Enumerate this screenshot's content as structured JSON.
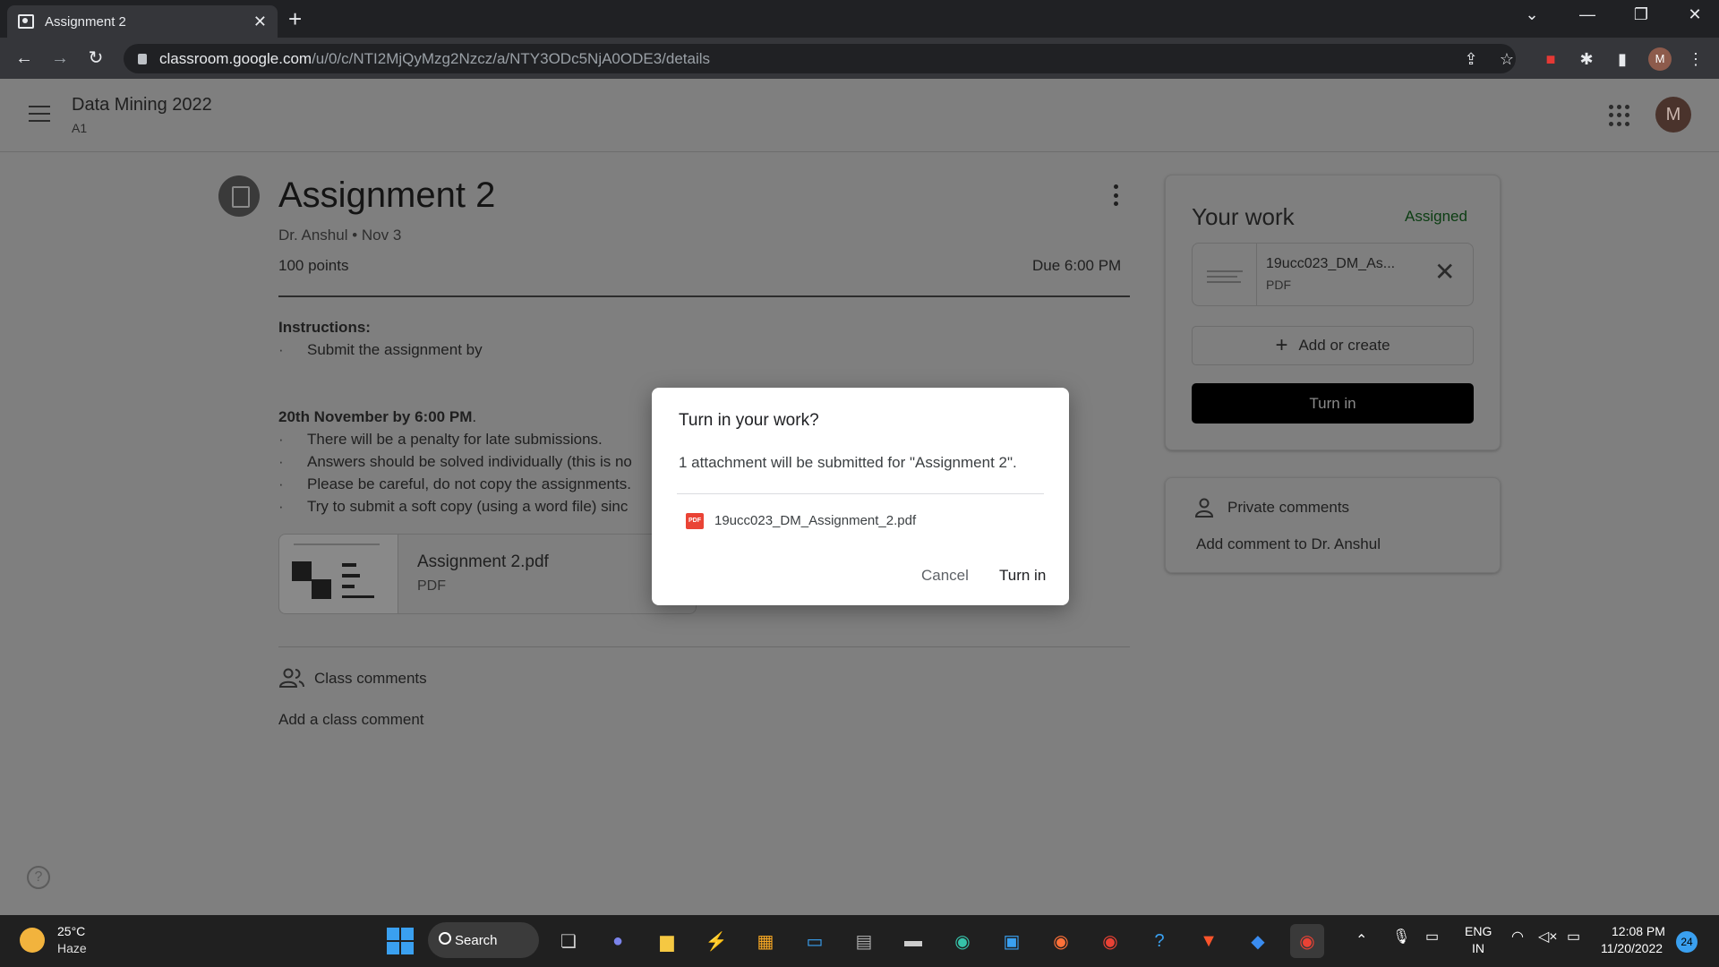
{
  "browser": {
    "tab_title": "Assignment 2",
    "tab_close": "✕",
    "new_tab": "+",
    "url_domain": "classroom.google.com",
    "url_path": "/u/0/c/NTI2MjQyMzg2Nzcz/a/NTY3ODc5NjA0ODE3/details",
    "profile_initial": "M"
  },
  "app": {
    "course_name": "Data Mining 2022",
    "course_section": "A1",
    "avatar_initial": "M"
  },
  "assignment": {
    "title": "Assignment 2",
    "author_date": "Dr. Anshul • Nov 3",
    "points": "100 points",
    "due": "Due 6:00 PM",
    "instructions_label": "Instructions:",
    "bullet1": "Submit the assignment by",
    "deadline_bold": "20th November by 6:00 PM",
    "deadline_rest": ".",
    "bullets": [
      "There will be a penalty for late submissions.",
      "Answers should be solved individually (this is no",
      "Please be careful, do not copy the assignments.",
      "Try to submit a soft copy (using a word file) sinc"
    ],
    "attachment_name": "Assignment 2.pdf",
    "attachment_type": "PDF"
  },
  "class_comments": {
    "label": "Class comments",
    "add": "Add a class comment"
  },
  "your_work": {
    "title": "Your work",
    "status": "Assigned",
    "status_color": "#0b3d12",
    "file_name": "19ucc023_DM_As...",
    "file_type": "PDF",
    "remove": "✕",
    "add_or_create": "Add or create",
    "turn_in": "Turn in"
  },
  "private_comments": {
    "label": "Private comments",
    "add": "Add comment to Dr. Anshul"
  },
  "dialog": {
    "title": "Turn in your work?",
    "message": "1 attachment will be submitted for \"Assignment 2\".",
    "pdf_badge": "PDF",
    "file": "19ucc023_DM_Assignment_2.pdf",
    "cancel": "Cancel",
    "turn_in": "Turn in"
  },
  "taskbar": {
    "temperature": "25°C",
    "weather": "Haze",
    "search": "Search",
    "lang_top": "ENG",
    "lang_bottom": "IN",
    "time": "12:08 PM",
    "date": "11/20/2022",
    "notifications": "24"
  }
}
